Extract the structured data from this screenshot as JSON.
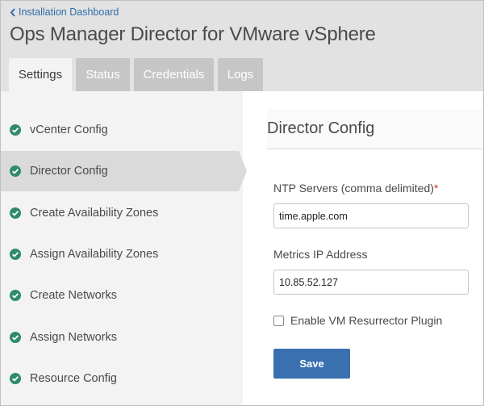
{
  "header": {
    "back_link": "Installation Dashboard",
    "title": "Ops Manager Director for VMware vSphere"
  },
  "tabs": [
    {
      "label": "Settings",
      "active": true
    },
    {
      "label": "Status",
      "active": false
    },
    {
      "label": "Credentials",
      "active": false
    },
    {
      "label": "Logs",
      "active": false
    }
  ],
  "sidebar": {
    "items": [
      {
        "label": "vCenter Config",
        "icon": "check-circle-icon"
      },
      {
        "label": "Director Config",
        "icon": "check-circle-icon",
        "active": true
      },
      {
        "label": "Create Availability Zones",
        "icon": "check-circle-icon"
      },
      {
        "label": "Assign Availability Zones",
        "icon": "check-circle-icon"
      },
      {
        "label": "Create Networks",
        "icon": "check-circle-icon"
      },
      {
        "label": "Assign Networks",
        "icon": "check-circle-icon"
      },
      {
        "label": "Resource Config",
        "icon": "check-circle-icon"
      }
    ]
  },
  "main": {
    "section_title": "Director Config",
    "ntp": {
      "label": "NTP Servers (comma delimited)",
      "required_mark": "*",
      "value": "time.apple.com"
    },
    "metrics": {
      "label": "Metrics IP Address",
      "value": "10.85.52.127"
    },
    "resurrector": {
      "label": "Enable VM Resurrector Plugin",
      "checked": false
    },
    "save_label": "Save"
  },
  "colors": {
    "accent": "#3a70b0",
    "check_green": "#2f8a70",
    "link": "#2e6ca8",
    "required": "#d0342c"
  }
}
